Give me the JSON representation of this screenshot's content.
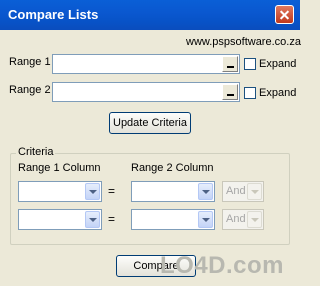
{
  "window": {
    "title": "Compare Lists"
  },
  "header": {
    "url": "www.pspsoftware.co.za"
  },
  "ranges": [
    {
      "label": "Range 1",
      "value": "",
      "expand_label": "Expand"
    },
    {
      "label": "Range 2",
      "value": "",
      "expand_label": "Expand"
    }
  ],
  "update_button": {
    "label": "Update Criteria"
  },
  "criteria": {
    "title": "Criteria",
    "col1_header": "Range 1 Column",
    "col2_header": "Range 2 Column",
    "rows": [
      {
        "range1": "",
        "equals": "=",
        "range2": "",
        "joiner": "And"
      },
      {
        "range1": "",
        "equals": "=",
        "range2": "",
        "joiner": "And"
      }
    ]
  },
  "compare_button": {
    "label": "Compare"
  },
  "watermark": {
    "text": "LO4D.com"
  },
  "icons": {
    "close": "close-icon",
    "dropdown": "chevron-down-icon",
    "range_picker": "minimize-collapse-icon"
  },
  "colors": {
    "titlebar": "#0a58d0",
    "dialog_bg": "#ece9d8",
    "close_button": "#c1381c"
  }
}
